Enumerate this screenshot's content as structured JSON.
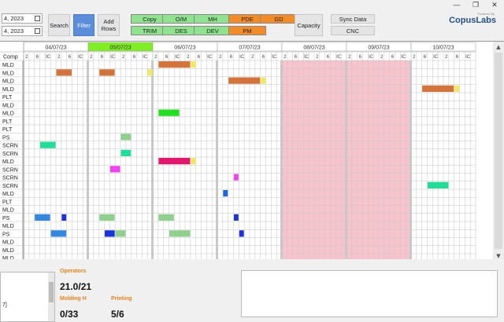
{
  "window": {
    "minimize": "—",
    "restore": "❐",
    "close": "✕"
  },
  "toolbar": {
    "date_from": "4, 2023",
    "date_to": "4, 2023",
    "search": "Search",
    "filter": "Filter",
    "add_rows": "Add Rows",
    "capacity": "Capacity",
    "sync_data": "Sync Data",
    "cnc": "CNC",
    "chips": [
      {
        "label": "Copy",
        "color": "#8fe38f"
      },
      {
        "label": "O/M",
        "color": "#8fe38f"
      },
      {
        "label": "MH",
        "color": "#8fe38f"
      },
      {
        "label": "PDE",
        "color": "#f28c28"
      },
      {
        "label": "GD",
        "color": "#f28c28"
      },
      {
        "label": "TRIM",
        "color": "#8fe38f"
      },
      {
        "label": "DES",
        "color": "#8fe38f"
      },
      {
        "label": "DEV",
        "color": "#8fe38f"
      },
      {
        "label": "PM",
        "color": "#f28c28"
      }
    ]
  },
  "logo": {
    "prefix": "Powered By",
    "name": "CopusLabs"
  },
  "schedule": {
    "comp_header": "Comp",
    "days": [
      {
        "label": "04/07/23",
        "highlight": false
      },
      {
        "label": "05/07/23",
        "highlight": true
      },
      {
        "label": "06/07/23",
        "highlight": false
      },
      {
        "label": "07/07/23",
        "highlight": false
      },
      {
        "label": "08/07/23",
        "highlight": false,
        "weekend": true
      },
      {
        "label": "09/07/23",
        "highlight": false,
        "weekend": true
      },
      {
        "label": "10/07/23",
        "highlight": false
      }
    ],
    "slot_labels": [
      "2",
      "6",
      "IC",
      "2",
      "6",
      "IC"
    ],
    "rows": [
      "MLD",
      "MLD",
      "MLD",
      "MLD",
      "PLT",
      "MLD",
      "MLD",
      "PLT",
      "PLT",
      "PS",
      "SCRN",
      "SCRN",
      "MLD",
      "SCRN",
      "SCRN",
      "SCRN",
      "MLD",
      "PLT",
      "MLD",
      "PS",
      "MLD",
      "PS",
      "MLD",
      "MLD",
      "MLD"
    ],
    "blocks": [
      {
        "row": 1,
        "day": 0,
        "start": 6,
        "len": 3,
        "color": "#d2743c"
      },
      {
        "row": 1,
        "day": 1,
        "start": 2,
        "len": 3,
        "color": "#d2743c"
      },
      {
        "row": 1,
        "day": 1,
        "start": 11,
        "len": 1,
        "color": "#f2ea5a"
      },
      {
        "row": 0,
        "day": 2,
        "start": 1,
        "len": 6,
        "color": "#d2743c"
      },
      {
        "row": 0,
        "day": 2,
        "start": 7,
        "len": 1,
        "color": "#f2ea5a"
      },
      {
        "row": 2,
        "day": 3,
        "start": 2,
        "len": 6,
        "color": "#d2743c"
      },
      {
        "row": 2,
        "day": 3,
        "start": 8,
        "len": 1,
        "color": "#f2ea5a"
      },
      {
        "row": 3,
        "day": 6,
        "start": 2,
        "len": 6,
        "color": "#d2743c"
      },
      {
        "row": 3,
        "day": 6,
        "start": 8,
        "len": 1,
        "color": "#f2ea5a"
      },
      {
        "row": 6,
        "day": 2,
        "start": 1,
        "len": 4,
        "color": "#22dd22"
      },
      {
        "row": 9,
        "day": 1,
        "start": 6,
        "len": 2,
        "color": "#8fd08f"
      },
      {
        "row": 10,
        "day": 0,
        "start": 3,
        "len": 3,
        "color": "#22dd99"
      },
      {
        "row": 11,
        "day": 1,
        "start": 6,
        "len": 2,
        "color": "#22dd99"
      },
      {
        "row": 12,
        "day": 2,
        "start": 1,
        "len": 6,
        "color": "#e0186e"
      },
      {
        "row": 12,
        "day": 2,
        "start": 7,
        "len": 1,
        "color": "#f2ea5a"
      },
      {
        "row": 13,
        "day": 1,
        "start": 4,
        "len": 2,
        "color": "#ee44ee"
      },
      {
        "row": 14,
        "day": 3,
        "start": 3,
        "len": 1,
        "color": "#ee44ee"
      },
      {
        "row": 15,
        "day": 6,
        "start": 3,
        "len": 4,
        "color": "#22dd99"
      },
      {
        "row": 16,
        "day": 3,
        "start": 1,
        "len": 1,
        "color": "#1a66dd"
      },
      {
        "row": 19,
        "day": 0,
        "start": 2,
        "len": 3,
        "color": "#3388dd"
      },
      {
        "row": 19,
        "day": 0,
        "start": 7,
        "len": 1,
        "color": "#1a33dd"
      },
      {
        "row": 19,
        "day": 1,
        "start": 2,
        "len": 3,
        "color": "#8fd08f"
      },
      {
        "row": 19,
        "day": 2,
        "start": 1,
        "len": 3,
        "color": "#8fd08f"
      },
      {
        "row": 19,
        "day": 3,
        "start": 3,
        "len": 1,
        "color": "#1a33dd"
      },
      {
        "row": 21,
        "day": 0,
        "start": 5,
        "len": 3,
        "color": "#3388dd"
      },
      {
        "row": 21,
        "day": 1,
        "start": 3,
        "len": 2,
        "color": "#1a33dd"
      },
      {
        "row": 21,
        "day": 1,
        "start": 5,
        "len": 2,
        "color": "#8fd08f"
      },
      {
        "row": 21,
        "day": 2,
        "start": 3,
        "len": 4,
        "color": "#8fd08f"
      },
      {
        "row": 21,
        "day": 3,
        "start": 4,
        "len": 1,
        "color": "#1a33dd"
      }
    ]
  },
  "stats": {
    "operators_label": "Operators",
    "operators_value": "21.0/21",
    "molding_label": "Molding H",
    "molding_value": "0/33",
    "printing_label": "Printing",
    "printing_value": "5/6"
  },
  "left_pane_text": "7]"
}
